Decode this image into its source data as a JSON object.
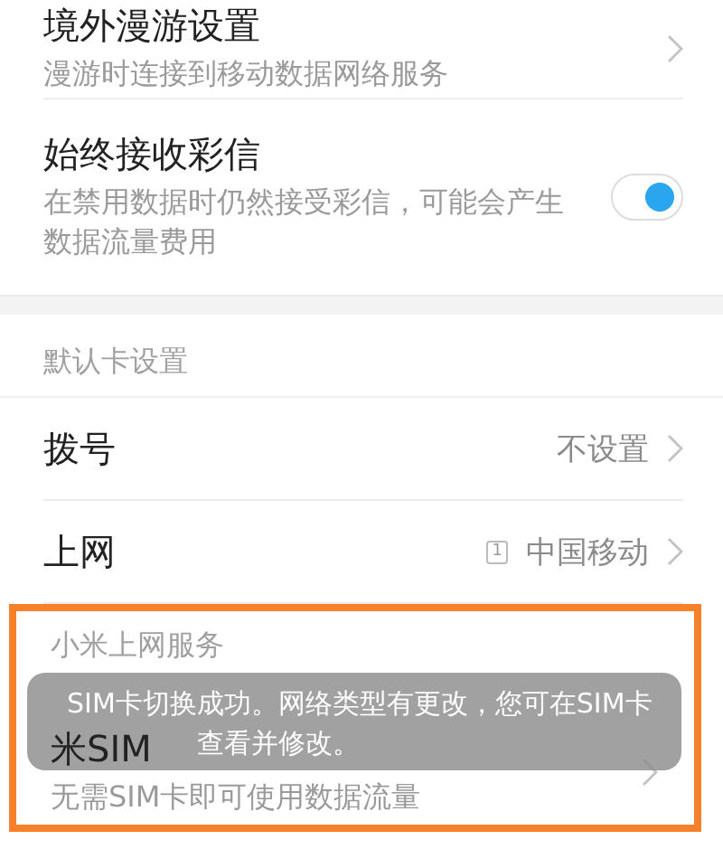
{
  "sections": [
    {
      "rows": [
        {
          "kind": "nav",
          "title": "境外漫游设置",
          "subtitle": "漫游时连接到移动数据网络服务"
        },
        {
          "kind": "toggle",
          "title": "始终接收彩信",
          "subtitle": "在禁用数据时仍然接受彩信，可能会产生数据流量费用",
          "on": true
        }
      ]
    },
    {
      "header": "默认卡设置",
      "rows": [
        {
          "kind": "value",
          "title": "拨号",
          "value": "不设置"
        },
        {
          "kind": "value",
          "title": "上网",
          "sim_badge": "1",
          "value": "中国移动"
        }
      ]
    },
    {
      "header": "小米上网服务",
      "highlighted": true,
      "rows": [
        {
          "kind": "nav",
          "title": "米SIM",
          "subtitle": "无需SIM卡即可使用数据流量"
        }
      ]
    }
  ],
  "toast": {
    "lines": [
      "SIM卡切换成功。网络类型有更改，您可在SIM卡",
      "查看并修改。"
    ]
  }
}
